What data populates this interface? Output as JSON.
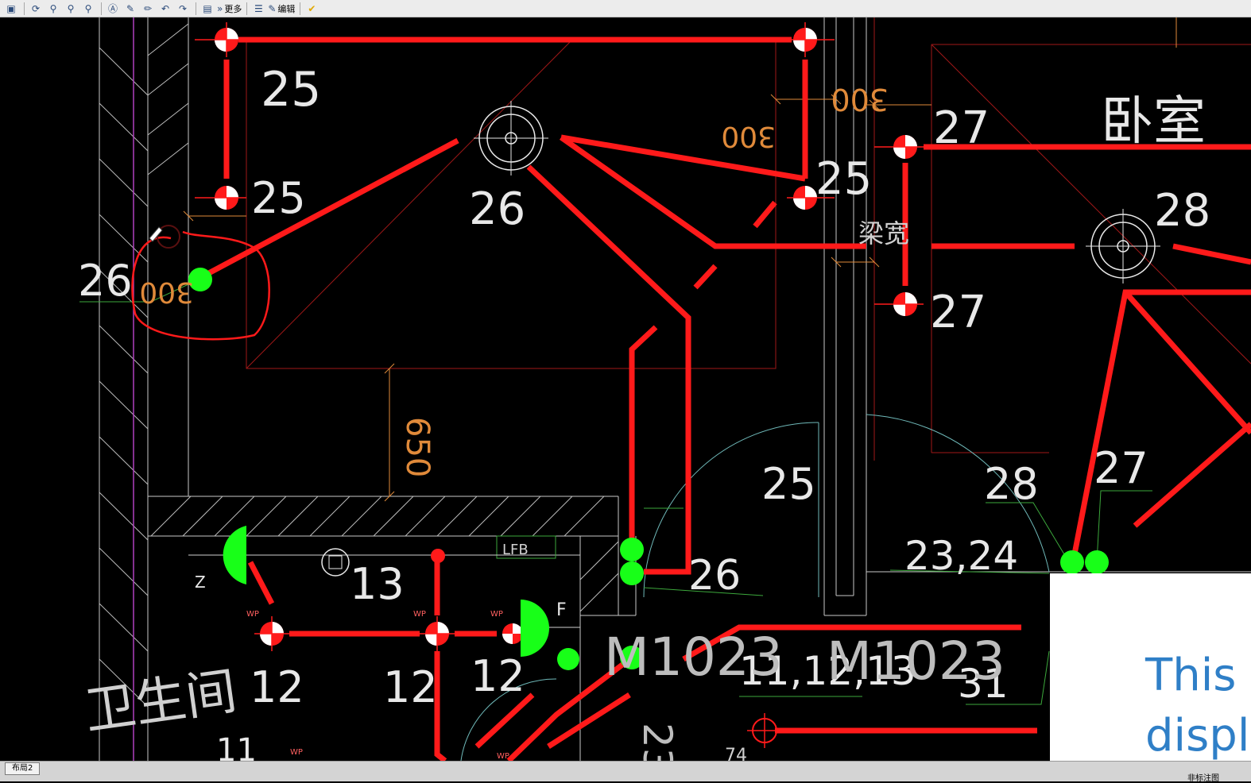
{
  "toolbar": {
    "more_label": "更多",
    "edit_label": "编辑"
  },
  "drawing": {
    "labels": {
      "n25a": "25",
      "n25b": "25",
      "n25c": "25",
      "n25d": "25",
      "n26a": "26",
      "n26b": "26",
      "n26c": "26",
      "n27a": "27",
      "n27b": "27",
      "n27c": "27",
      "n28a": "28",
      "n28b": "28",
      "n2324": "23,24",
      "n13": "13",
      "n12a": "12",
      "n12b": "12",
      "n12c": "12",
      "n111213": "11,12,13",
      "n31": "31",
      "n23": "23",
      "n11": "11",
      "m1023a": "M1023",
      "m1023b": "M1023",
      "dim300a": "300",
      "dim300b": "300",
      "dim300c": "300",
      "dim650": "650",
      "bedroom": "卧室",
      "beam": "梁宽",
      "bathroom": "卫生间",
      "lfb": "LFB",
      "f": "F",
      "z": "Z",
      "wp": "WP",
      "n74": "74"
    }
  },
  "statusbar": {
    "tab": "布局2",
    "right_text": "非标注图"
  },
  "overlay": {
    "line1": "This p",
    "line2": "displa"
  }
}
